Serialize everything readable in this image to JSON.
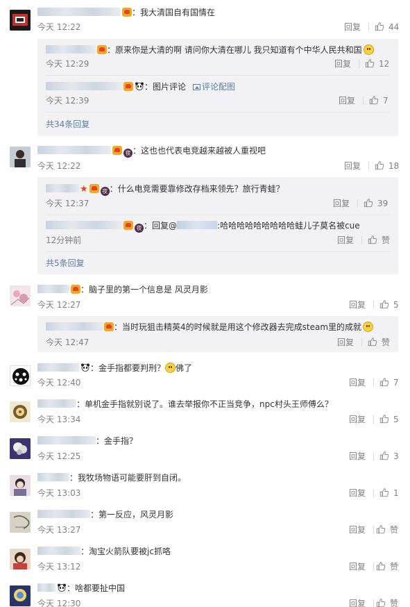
{
  "ui": {
    "reply_label": "回复",
    "like_zero_label": "赞",
    "pic_comment_link": "评论配图"
  },
  "comments": [
    {
      "text": "我大清国自有国情在",
      "time": "今天 12:22",
      "likes": "44",
      "thread": {
        "replies": [
          {
            "text": "原来你是大清的啊 请问你大清在哪儿 我只知道有个中华人民共和国",
            "time": "今天 12:29",
            "likes": "12"
          },
          {
            "text": "图片评论",
            "time": "今天 12:39",
            "likes": "7"
          }
        ],
        "more": "共34条回复"
      }
    },
    {
      "text": "这也也代表电竞越来越被人重视吧",
      "time": "今天 12:22",
      "likes": "18",
      "thread": {
        "replies": [
          {
            "text": "什么电竞需要靠修改存档来领先？旅行青蛙？",
            "time": "今天 12:37",
            "likes": "39"
          },
          {
            "reply_prefix": "回复@",
            "text": "哈哈哈哈哈哈哈哈哈蛙儿子莫名被cue",
            "time": "12分钟前",
            "likes": "赞"
          }
        ],
        "more": "共5条回复"
      }
    },
    {
      "text": "脑子里的第一个信息是 风灵月影",
      "time": "今天 12:27",
      "likes": "5",
      "thread": {
        "replies": [
          {
            "text": "当时玩狙击精英4的时候就是用这个修改器去完成steam里的成就",
            "time": "今天 12:47",
            "likes": "赞"
          }
        ]
      }
    },
    {
      "text": "金手指都要判刑？",
      "text_after": "佛了",
      "time": "今天 12:40",
      "likes": "7"
    },
    {
      "text": "单机金手指就别说了。谁去举报你不正当竞争，npc村头王师傅么？",
      "time": "今天 13:34",
      "likes": "5"
    },
    {
      "text": "金手指？",
      "time": "今天 12:25",
      "likes": "3"
    },
    {
      "text": "我牧场物语可能要肝到自闭。",
      "time": "今天 13:03",
      "likes": "1"
    },
    {
      "text": "第一反应，风灵月影",
      "time": "今天 13:27",
      "likes": "赞"
    },
    {
      "text": "淘宝火箭队要被jc抓咯",
      "time": "今天 13:12",
      "likes": "赞"
    },
    {
      "text": "啥都要扯中国",
      "time": "今天 12:30",
      "likes": "赞"
    }
  ]
}
